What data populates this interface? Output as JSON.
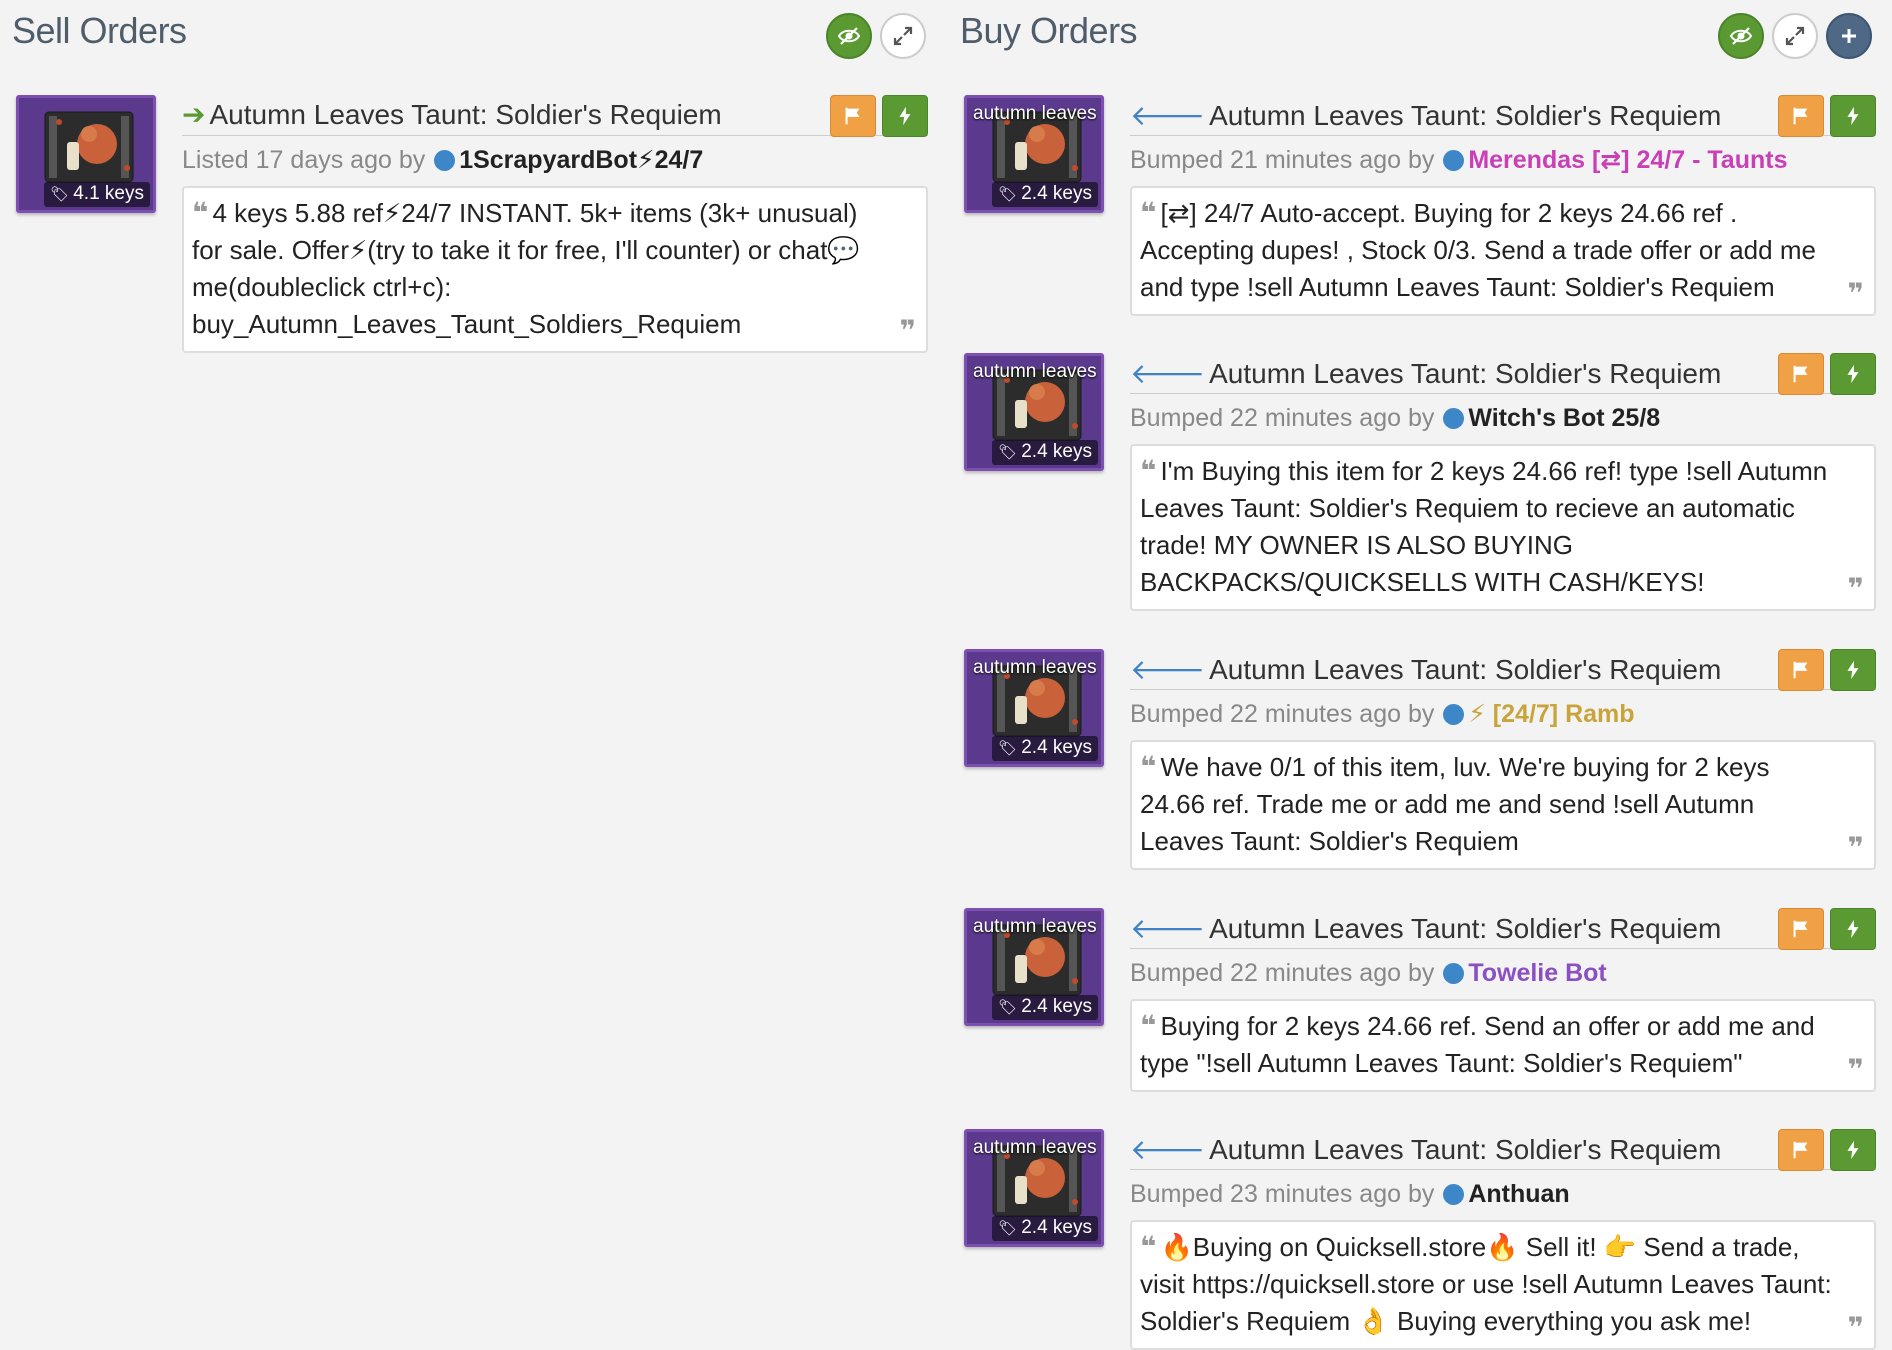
{
  "sell_column": {
    "title": "Sell Orders",
    "listings": [
      {
        "title": "Autumn Leaves Taunt: Soldier's Requiem",
        "price": "4.1 keys",
        "caption": "",
        "time_prefix": "Listed 17 days ago by",
        "user": "1ScrapyardBot⚡24/7",
        "user_color": "#222222",
        "message": "4 keys 5.88 ref⚡24/7 INSTANT. 5k+ items (3k+ unusual) for sale. Offer⚡(try to take it for free, I'll counter) or chat💬 me(doubleclick ctrl+c): buy_Autumn_Leaves_Taunt_Soldiers_Requiem"
      }
    ]
  },
  "buy_column": {
    "title": "Buy Orders",
    "listings": [
      {
        "title": "Autumn Leaves Taunt: Soldier's Requiem",
        "price": "2.4 keys",
        "caption": "autumn leaves",
        "time_prefix": "Bumped 21 minutes ago by",
        "user": "Merendas [⇄] 24/7 - Taunts",
        "user_color": "#c93fb5",
        "message": "[⇄] 24/7 Auto-accept. Buying for 2 keys 24.66 ref . Accepting dupes! , Stock 0/3. Send a trade offer or add me and type !sell Autumn Leaves Taunt: Soldier's Requiem"
      },
      {
        "title": "Autumn Leaves Taunt: Soldier's Requiem",
        "price": "2.4 keys",
        "caption": "autumn leaves",
        "time_prefix": "Bumped 22 minutes ago by",
        "user": "Witch's Bot 25/8",
        "user_color": "#222222",
        "message": "I'm Buying this item for 2 keys 24.66 ref! type !sell Autumn Leaves Taunt: Soldier's Requiem to recieve an automatic trade! MY OWNER IS ALSO BUYING BACKPACKS/QUICKSELLS WITH CASH/KEYS!"
      },
      {
        "title": "Autumn Leaves Taunt: Soldier's Requiem",
        "price": "2.4 keys",
        "caption": "autumn leaves",
        "time_prefix": "Bumped 22 minutes ago by",
        "user": "⚡ [24/7] Ramb",
        "user_color": "#c8a43a",
        "message": "We have 0/1 of this item, luv. We're buying for 2 keys 24.66 ref. Trade me or add me and send !sell Autumn Leaves Taunt: Soldier's Requiem"
      },
      {
        "title": "Autumn Leaves Taunt: Soldier's Requiem",
        "price": "2.4 keys",
        "caption": "autumn leaves",
        "time_prefix": "Bumped 22 minutes ago by",
        "user": "Towelie Bot",
        "user_color": "#8a4fc2",
        "message": "Buying for 2 keys 24.66 ref. Send an offer or add me and type \"!sell Autumn Leaves Taunt: Soldier's Requiem\""
      },
      {
        "title": "Autumn Leaves Taunt: Soldier's Requiem",
        "price": "2.4 keys",
        "caption": "autumn leaves",
        "time_prefix": "Bumped 23 minutes ago by",
        "user": "Anthuan",
        "user_color": "#222222",
        "message": "🔥Buying on Quicksell.store🔥 Sell it! 👉 Send a trade, visit https://quicksell.store or use !sell Autumn Leaves Taunt: Soldier's Requiem 👌 Buying everything you ask me!"
      }
    ]
  }
}
